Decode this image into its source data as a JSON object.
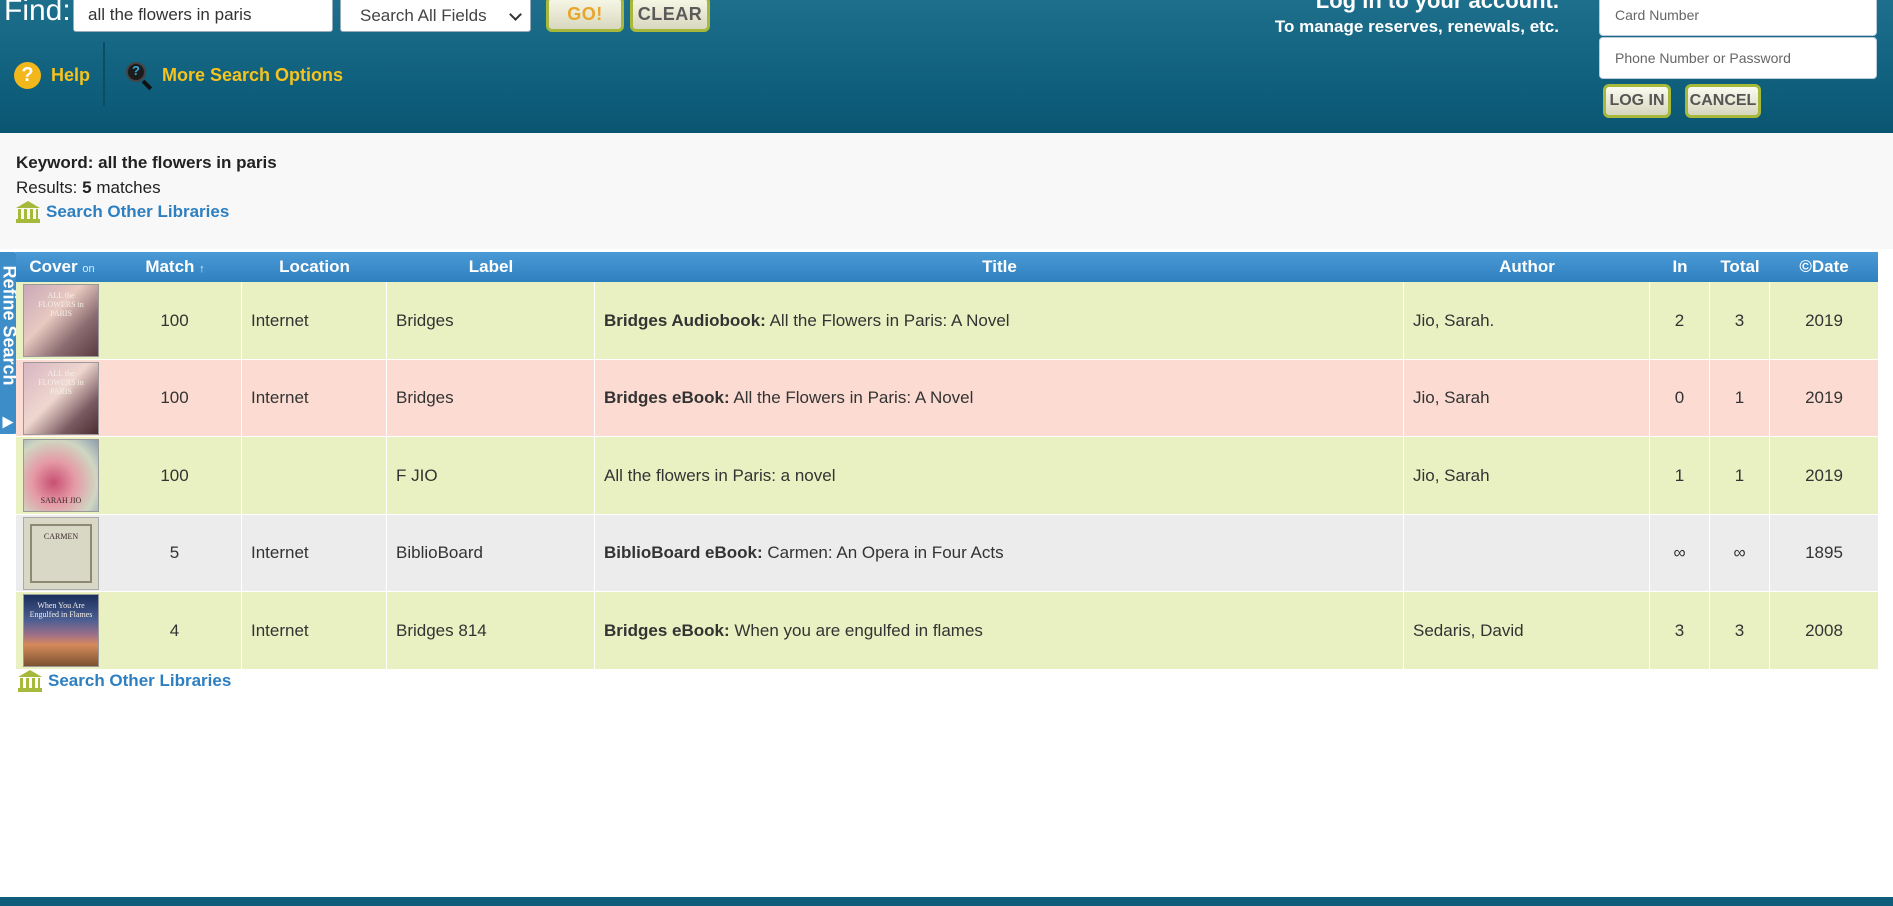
{
  "search": {
    "find_label": "Find:",
    "query": "all the flowers in paris",
    "field_select": "Search All Fields",
    "go_label": "GO!",
    "clear_label": "CLEAR",
    "help_label": "Help",
    "more_options_label": "More Search Options"
  },
  "login": {
    "title": "Log in to your account.",
    "subtitle": "To manage reserves, renewals, etc.",
    "card_placeholder": "Card Number",
    "password_placeholder": "Phone Number or Password",
    "login_label": "LOG IN",
    "cancel_label": "CANCEL"
  },
  "summary": {
    "keyword_label": "Keyword: all the flowers in paris",
    "results_prefix": "Results: ",
    "results_count": "5",
    "results_suffix": " matches",
    "search_other_libraries": "Search Other Libraries"
  },
  "refine_label": "Refine Search",
  "table": {
    "headers": {
      "cover": "Cover",
      "cover_toggle": "on",
      "match": "Match",
      "match_sort": "↑",
      "location": "Location",
      "label": "Label",
      "title": "Title",
      "author": "Author",
      "in": "In",
      "total": "Total",
      "date": "©Date"
    },
    "rows": [
      {
        "cover_text": "ALL the FLOWERS in PARIS",
        "match": "100",
        "location": "Internet",
        "label": "Bridges",
        "title_prefix": "Bridges Audiobook:",
        "title": " All the Flowers in Paris: A Novel",
        "author": "Jio, Sarah.",
        "in": "2",
        "total": "3",
        "date": "2019"
      },
      {
        "cover_text": "ALL the FLOWERS in PARIS",
        "match": "100",
        "location": "Internet",
        "label": "Bridges",
        "title_prefix": "Bridges eBook:",
        "title": " All the Flowers in Paris: A Novel",
        "author": "Jio, Sarah",
        "in": "0",
        "total": "1",
        "date": "2019"
      },
      {
        "cover_text": "SARAH JIO",
        "match": "100",
        "location": "",
        "label": "F JIO",
        "title_prefix": "",
        "title": "All the flowers in Paris: a novel",
        "author": "Jio, Sarah",
        "in": "1",
        "total": "1",
        "date": "2019"
      },
      {
        "cover_text": "CARMEN",
        "match": "5",
        "location": "Internet",
        "label": "BiblioBoard",
        "title_prefix": "BiblioBoard eBook:",
        "title": " Carmen: An Opera in Four Acts",
        "author": "",
        "in": "∞",
        "total": "∞",
        "date": "1895"
      },
      {
        "cover_text": "When You Are Engulfed in Flames",
        "match": "4",
        "location": "Internet",
        "label": "Bridges 814",
        "title_prefix": "Bridges eBook:",
        "title": " When you are engulfed in flames",
        "author": "Sedaris, David",
        "in": "3",
        "total": "3",
        "date": "2008"
      }
    ]
  },
  "colors": {
    "header_bg": "#0e5e7b",
    "accent_yellow": "#f4c31f",
    "link_blue": "#2e7fc0",
    "table_header": "#3d8dc8",
    "row_green": "#e9f1c2",
    "row_pink": "#fcdcd2",
    "row_grey": "#ececec"
  }
}
